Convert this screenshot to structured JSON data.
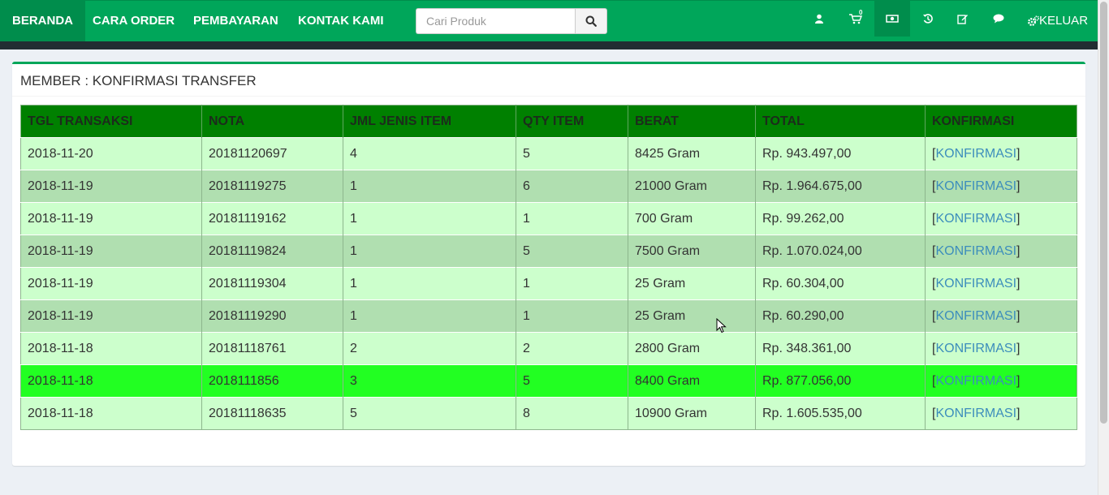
{
  "nav": {
    "items": [
      {
        "label": "BERANDA"
      },
      {
        "label": "CARA ORDER"
      },
      {
        "label": "PEMBAYARAN"
      },
      {
        "label": "KONTAK KAMI"
      }
    ],
    "search_placeholder": "Cari Produk",
    "cart_count": "0",
    "logout_label": "KELUAR",
    "icons": [
      "user-icon",
      "cart-icon",
      "money-icon",
      "history-icon",
      "edit-icon",
      "comment-icon",
      "cogs-icon"
    ]
  },
  "page": {
    "title": "MEMBER : KONFIRMASI TRANSFER"
  },
  "table": {
    "headers": [
      "TGL TRANSAKSI",
      "NOTA",
      "JML JENIS ITEM",
      "QTY ITEM",
      "BERAT",
      "TOTAL",
      "KONFIRMASI"
    ],
    "rows": [
      {
        "tgl": "2018-11-20",
        "nota": "20181120697",
        "jenis": "4",
        "qty": "5",
        "berat": "8425 Gram",
        "total": "Rp. 943.497,00"
      },
      {
        "tgl": "2018-11-19",
        "nota": "20181119275",
        "jenis": "1",
        "qty": "6",
        "berat": "21000 Gram",
        "total": "Rp. 1.964.675,00"
      },
      {
        "tgl": "2018-11-19",
        "nota": "20181119162",
        "jenis": "1",
        "qty": "1",
        "berat": "700 Gram",
        "total": "Rp. 99.262,00"
      },
      {
        "tgl": "2018-11-19",
        "nota": "20181119824",
        "jenis": "1",
        "qty": "5",
        "berat": "7500 Gram",
        "total": "Rp. 1.070.024,00"
      },
      {
        "tgl": "2018-11-19",
        "nota": "20181119304",
        "jenis": "1",
        "qty": "1",
        "berat": "25 Gram",
        "total": "Rp. 60.304,00"
      },
      {
        "tgl": "2018-11-19",
        "nota": "20181119290",
        "jenis": "1",
        "qty": "1",
        "berat": "25 Gram",
        "total": "Rp. 60.290,00"
      },
      {
        "tgl": "2018-11-18",
        "nota": "20181118761",
        "jenis": "2",
        "qty": "2",
        "berat": "2800 Gram",
        "total": "Rp. 348.361,00"
      },
      {
        "tgl": "2018-11-18",
        "nota": "2018111856",
        "jenis": "3",
        "qty": "5",
        "berat": "8400 Gram",
        "total": "Rp. 877.056,00"
      },
      {
        "tgl": "2018-11-18",
        "nota": "20181118635",
        "jenis": "5",
        "qty": "8",
        "berat": "10900 Gram",
        "total": "Rp. 1.605.535,00"
      }
    ],
    "link_label": "KONFIRMASI",
    "bracket_open": "[",
    "bracket_close": "]"
  },
  "colors": {
    "navbar": "#00a65a",
    "navbar_active": "#008d4c",
    "table_header": "#008000",
    "row_light": "#ccffcc",
    "row_dark": "#b0dfb0",
    "row_highlight": "#22ff22",
    "link": "#3c8dbc"
  }
}
